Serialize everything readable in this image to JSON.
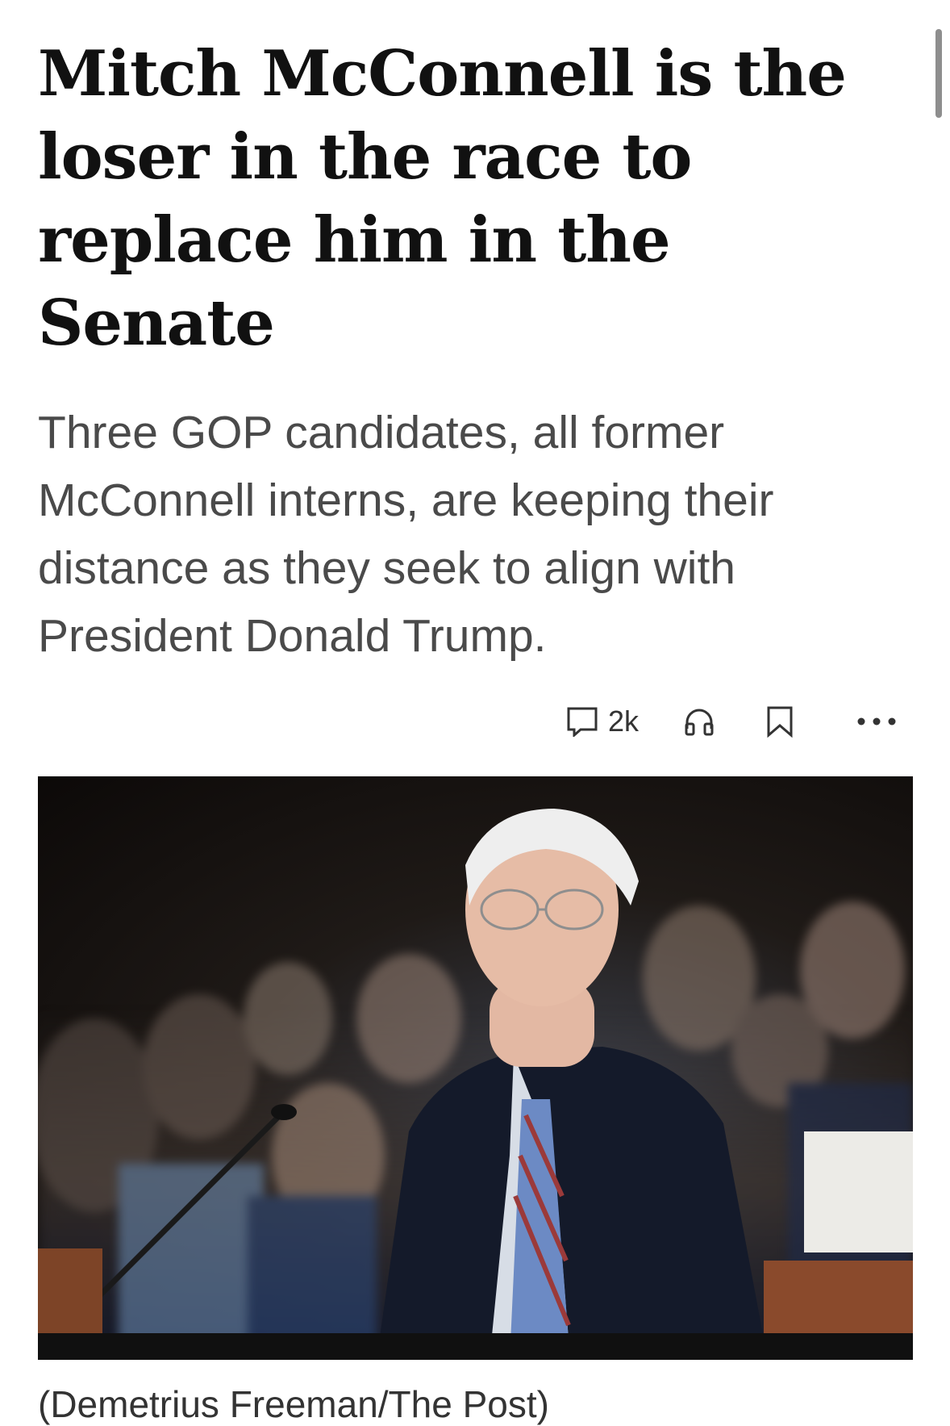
{
  "article": {
    "headline": "Mitch McConnell is the loser in the race to replace him in the Senate",
    "dek": "Three GOP candidates, all former McConnell interns, are keeping their distance as they seek to align with President Donald Trump.",
    "actions": {
      "comment_count": "2k",
      "comment_icon": "comment-icon",
      "listen_icon": "headphones-icon",
      "save_icon": "bookmark-icon",
      "more_icon": "more-options-icon"
    },
    "photo": {
      "description_icon": "article-photo"
    },
    "caption": "(Demetrius Freeman/The Post)"
  },
  "colors": {
    "headline": "#111111",
    "dek": "#4a4a4a",
    "icon": "#333333"
  }
}
